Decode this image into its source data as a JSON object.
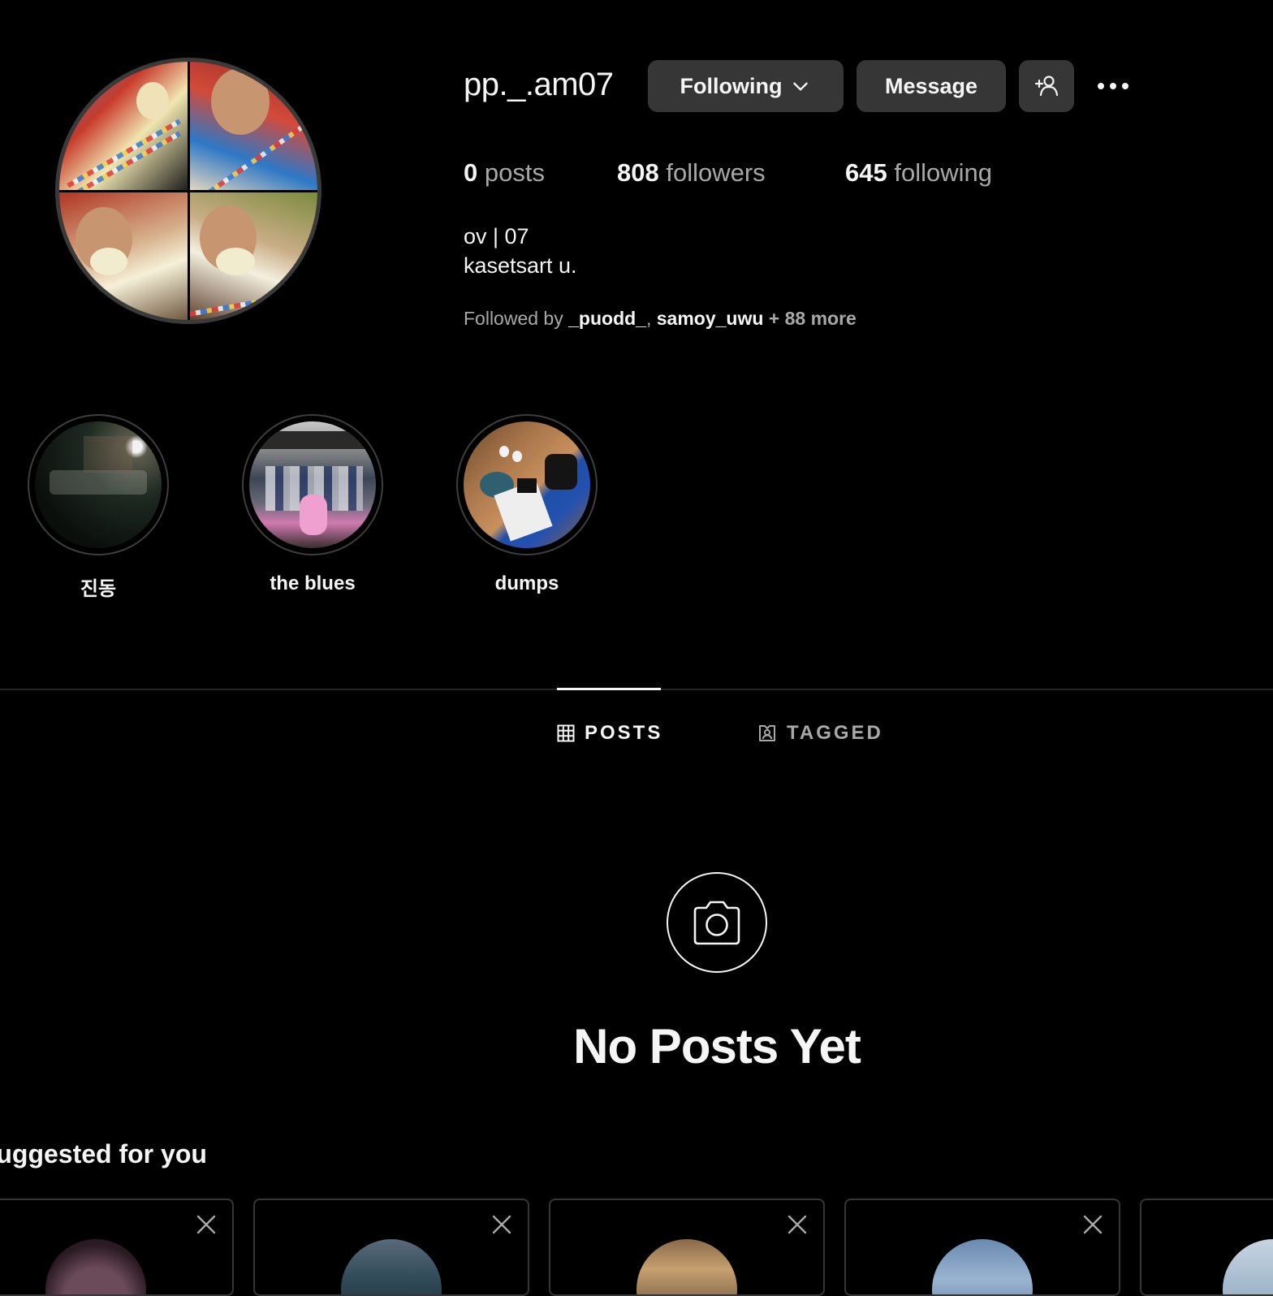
{
  "profile": {
    "username": "pp._.am07",
    "following_button": "Following",
    "message_button": "Message",
    "stats": {
      "posts_count": "0",
      "posts_label": "posts",
      "followers_count": "808",
      "followers_label": "followers",
      "following_count": "645",
      "following_label": "following"
    },
    "bio_line1": "ov | 07",
    "bio_line2": "kasetsart u.",
    "followed_by": {
      "prefix": "Followed by ",
      "user1": "_puodd_",
      "sep": ", ",
      "user2": "samoy_uwu",
      "more": " + 88 more"
    }
  },
  "highlights": [
    {
      "label": "진동"
    },
    {
      "label": "the blues"
    },
    {
      "label": "dumps"
    }
  ],
  "tabs": {
    "posts": "POSTS",
    "tagged": "TAGGED"
  },
  "empty_state": {
    "title": "No Posts Yet"
  },
  "suggested": {
    "title": "Suggested for you"
  },
  "icons": {
    "chevron": "chevron-down-icon",
    "add_person": "add-person-icon",
    "more": "more-options-icon",
    "grid": "grid-icon",
    "tagged": "tagged-icon",
    "camera": "camera-icon",
    "close": "close-icon"
  },
  "colors": {
    "background": "#000000",
    "button": "#363636",
    "text_primary": "#f5f5f5",
    "text_secondary": "#a8a8a8"
  }
}
